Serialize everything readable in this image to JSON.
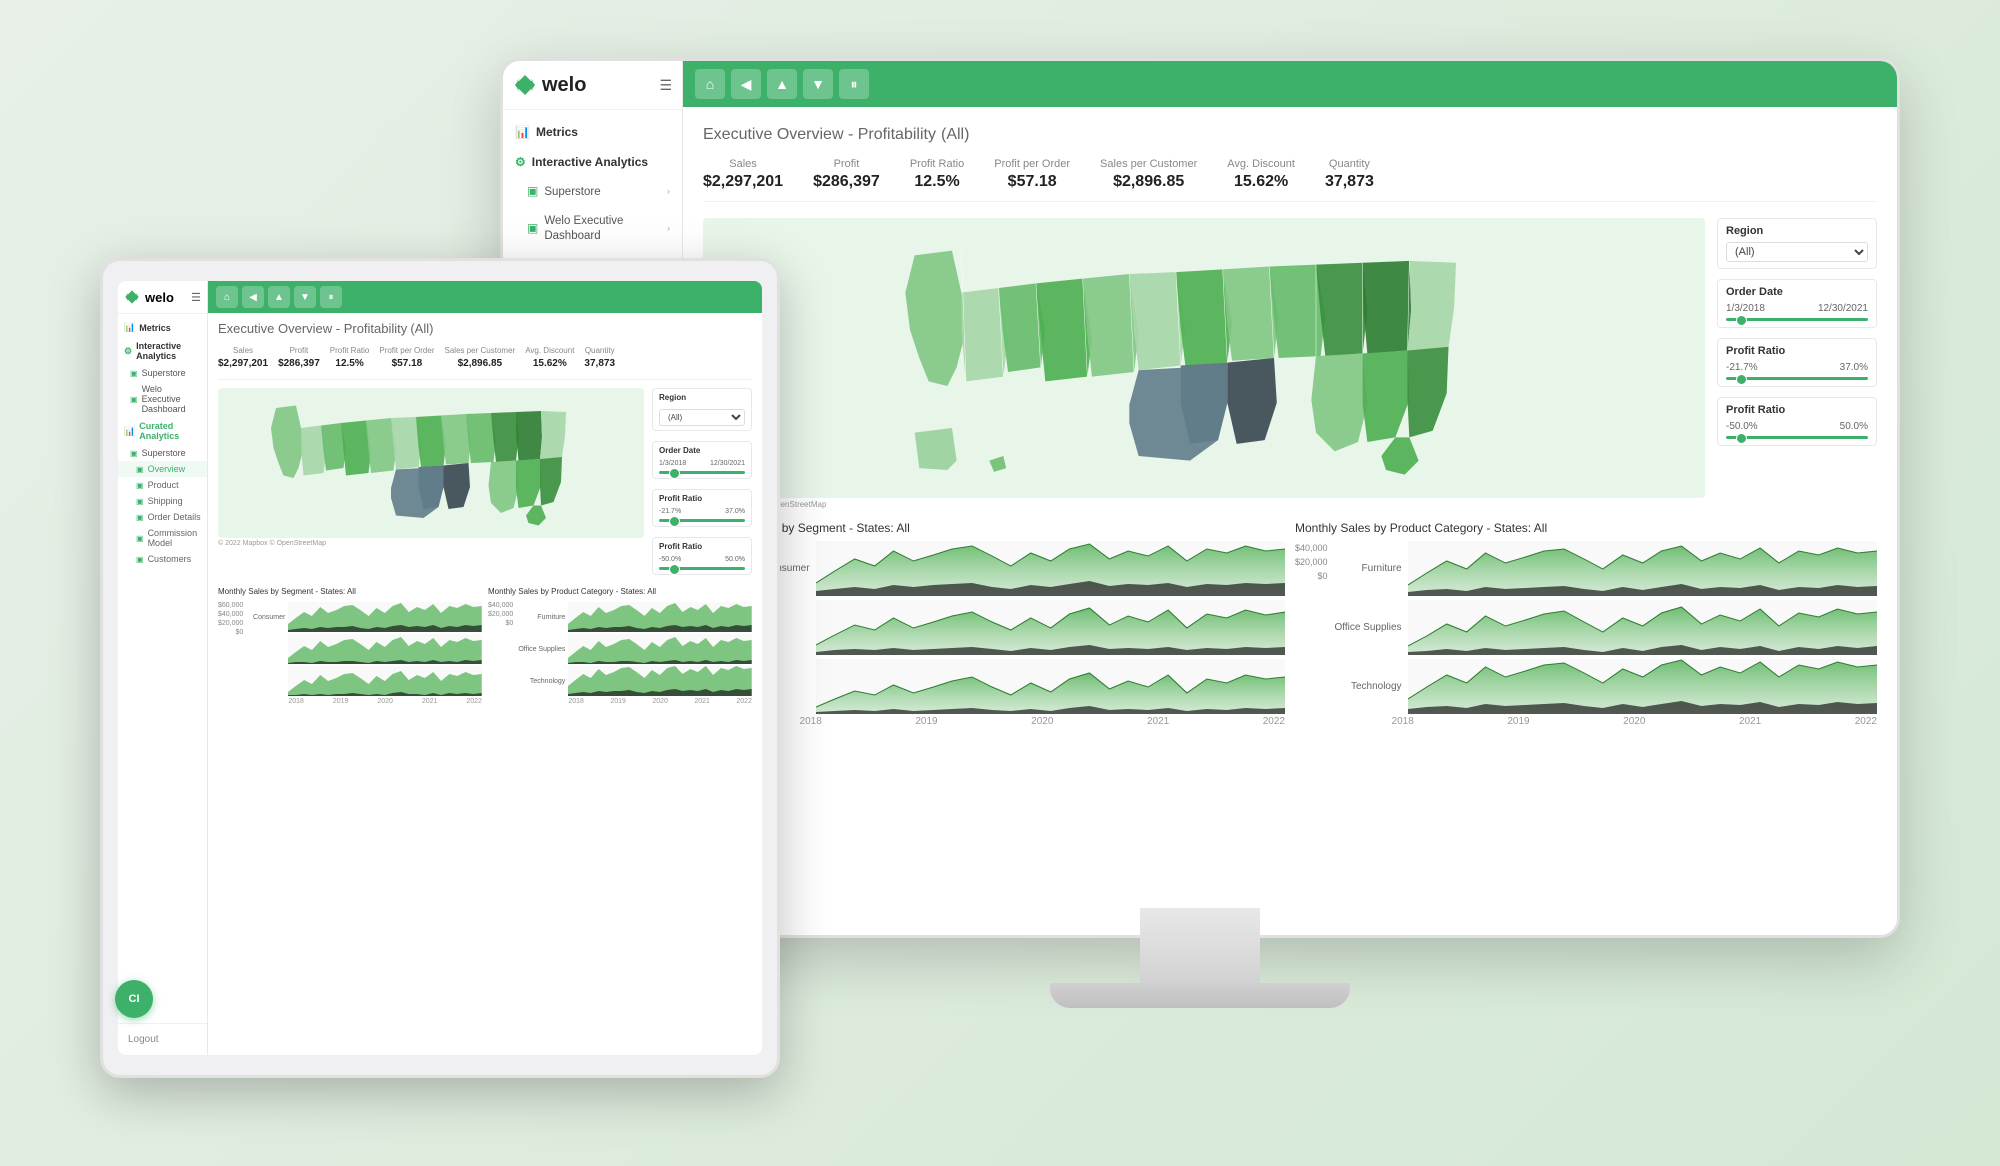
{
  "brand": {
    "name": "welo",
    "logo_symbol": "≋"
  },
  "sidebar": {
    "hamburger": "☰",
    "sections": [
      {
        "id": "metrics",
        "label": "Metrics",
        "icon": "📊",
        "type": "section-header"
      },
      {
        "id": "interactive-analytics",
        "label": "Interactive Analytics",
        "icon": "⚙",
        "type": "section-header"
      },
      {
        "id": "superstore",
        "label": "Superstore",
        "icon": "▣",
        "type": "sub-item",
        "hasArrow": true
      },
      {
        "id": "welo-executive-dashboard",
        "label": "Welo Executive Dashboard",
        "icon": "▣",
        "type": "sub-item",
        "hasArrow": true
      },
      {
        "id": "curated-analytics",
        "label": "Curated Analytics",
        "icon": "📊",
        "type": "section-header"
      },
      {
        "id": "superstore-ca",
        "label": "Superstore",
        "icon": "▣",
        "type": "sub-item",
        "hasArrow": true
      },
      {
        "id": "overview",
        "label": "Overview",
        "icon": "▣",
        "type": "sub-sub-item",
        "active": true
      },
      {
        "id": "product",
        "label": "Product",
        "icon": "▣",
        "type": "sub-sub-item"
      },
      {
        "id": "shipping",
        "label": "Shipping",
        "icon": "▣",
        "type": "sub-sub-item"
      },
      {
        "id": "order-details",
        "label": "Order Details",
        "icon": "▣",
        "type": "sub-sub-item"
      },
      {
        "id": "commission-model",
        "label": "Commission Model",
        "icon": "▣",
        "type": "sub-sub-item"
      },
      {
        "id": "customers",
        "label": "Customers",
        "icon": "▣",
        "type": "sub-sub-item"
      }
    ],
    "logout": "Logout"
  },
  "toolbar": {
    "buttons": [
      {
        "id": "home",
        "icon": "⌂",
        "label": "Home"
      },
      {
        "id": "back",
        "icon": "◀",
        "label": "Back"
      },
      {
        "id": "forward",
        "icon": "▲",
        "label": "Forward"
      },
      {
        "id": "filter",
        "icon": "▼",
        "label": "Filter"
      },
      {
        "id": "pause",
        "icon": "⏸",
        "label": "Pause"
      }
    ]
  },
  "page": {
    "title": "Executive Overview - Profitability",
    "title_filter": "(All)",
    "mapbox_credit": "© 2022 Mapbox © OpenStreetMap"
  },
  "kpis": [
    {
      "label": "Sales",
      "value": "$2,297,201"
    },
    {
      "label": "Profit",
      "value": "$286,397"
    },
    {
      "label": "Profit Ratio",
      "value": "12.5%"
    },
    {
      "label": "Profit per Order",
      "value": "$57.18"
    },
    {
      "label": "Sales per Customer",
      "value": "$2,896.85"
    },
    {
      "label": "Avg. Discount",
      "value": "15.62%"
    },
    {
      "label": "Quantity",
      "value": "37,873"
    }
  ],
  "filters": {
    "region": {
      "label": "Region",
      "value": "(All)"
    },
    "order_date": {
      "label": "Order Date",
      "from": "1/3/2018",
      "to": "12/30/2021"
    },
    "profit_ratio_range": {
      "label": "Profit Ratio",
      "min": "-21.7%",
      "max": "37.0%"
    },
    "profit_ratio_bar": {
      "label": "Profit Ratio",
      "min": "-50.0%",
      "max": "50.0%"
    }
  },
  "charts": {
    "segment_title": "Monthly Sales by Segment - States: All",
    "product_title": "Monthly Sales by Product Category - States: All",
    "segments": [
      {
        "label": "Consumer",
        "values": [
          10,
          25,
          15,
          30,
          20,
          35,
          18,
          28,
          22,
          40,
          15,
          25,
          30,
          20,
          35,
          28,
          40,
          25,
          30,
          45,
          20,
          35,
          28,
          45
        ]
      },
      {
        "label": "",
        "values": [
          8,
          18,
          12,
          22,
          15,
          28,
          12,
          20,
          16,
          30,
          10,
          18,
          22,
          14,
          28,
          20,
          32,
          18,
          24,
          38,
          14,
          28,
          20,
          38
        ]
      },
      {
        "label": "",
        "values": [
          5,
          12,
          8,
          15,
          10,
          18,
          8,
          14,
          11,
          22,
          7,
          13,
          15,
          10,
          20,
          14,
          24,
          13,
          18,
          28,
          10,
          20,
          14,
          28
        ]
      }
    ],
    "categories": [
      {
        "label": "Furniture",
        "values": [
          8,
          20,
          12,
          25,
          16,
          30,
          14,
          22,
          18,
          35,
          12,
          20,
          25,
          16,
          30,
          22,
          35,
          20,
          26,
          40,
          16,
          30,
          22,
          40
        ]
      },
      {
        "label": "Office Supplies",
        "values": [
          6,
          15,
          10,
          18,
          12,
          22,
          10,
          16,
          14,
          28,
          9,
          15,
          18,
          12,
          24,
          16,
          28,
          14,
          20,
          32,
          12,
          22,
          16,
          32
        ]
      },
      {
        "label": "Technology",
        "values": [
          10,
          22,
          14,
          28,
          18,
          35,
          16,
          26,
          20,
          38,
          14,
          22,
          28,
          18,
          35,
          24,
          38,
          22,
          30,
          45,
          18,
          35,
          26,
          45
        ]
      }
    ],
    "years_segment": [
      "2018",
      "2019",
      "2020",
      "2021",
      "2022"
    ],
    "years_category": [
      "2018",
      "2019",
      "2020",
      "2021",
      "2022"
    ],
    "y_labels_sales": [
      "$60,000",
      "$40,000",
      "$20,000",
      "$0"
    ],
    "y_labels_category": [
      "$40,000",
      "$20,000",
      "$0"
    ]
  },
  "tablet": {
    "ci_badge": "CI"
  }
}
